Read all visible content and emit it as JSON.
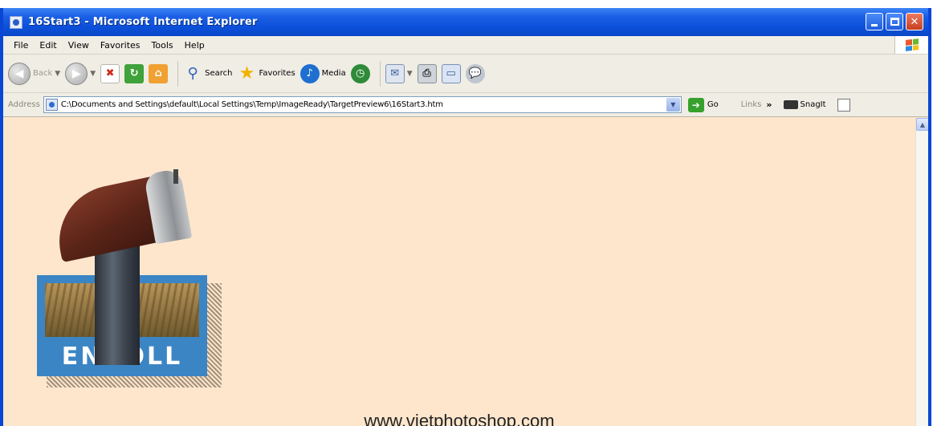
{
  "window": {
    "title": "16Start3 - Microsoft Internet Explorer"
  },
  "menu": {
    "items": [
      "File",
      "Edit",
      "View",
      "Favorites",
      "Tools",
      "Help"
    ]
  },
  "toolbar": {
    "back_label": "Back",
    "search_label": "Search",
    "favorites_label": "Favorites",
    "media_label": "Media"
  },
  "address": {
    "label": "Address",
    "url": "C:\\Documents and Settings\\default\\Local Settings\\Temp\\ImageReady\\TargetPreview6\\16Start3.htm",
    "go_label": "Go",
    "links_label": "Links",
    "links_chevron": "»",
    "snagit_label": "SnagIt"
  },
  "content": {
    "enroll_label": "ENROLL",
    "watermark": "www.vietphotoshop.com"
  },
  "colors": {
    "titlebar": "#0b4fd9",
    "page_background": "#fde6cc",
    "enroll_frame": "#3b85c4"
  }
}
